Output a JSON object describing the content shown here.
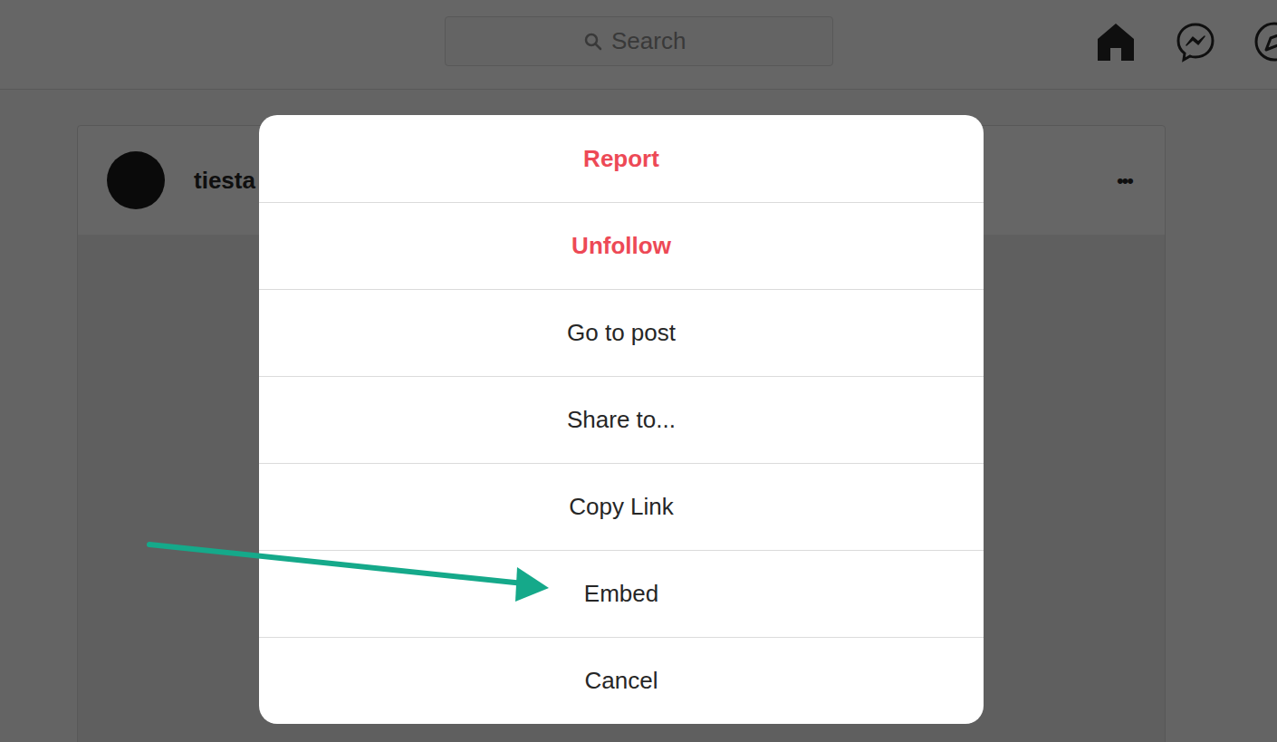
{
  "search": {
    "placeholder": "Search"
  },
  "post": {
    "username": "tiesta",
    "more": "•••"
  },
  "menu": {
    "items": [
      {
        "label": "Report",
        "kind": "danger"
      },
      {
        "label": "Unfollow",
        "kind": "danger"
      },
      {
        "label": "Go to post",
        "kind": "normal"
      },
      {
        "label": "Share to...",
        "kind": "normal"
      },
      {
        "label": "Copy Link",
        "kind": "normal"
      },
      {
        "label": "Embed",
        "kind": "normal"
      },
      {
        "label": "Cancel",
        "kind": "normal"
      }
    ]
  }
}
